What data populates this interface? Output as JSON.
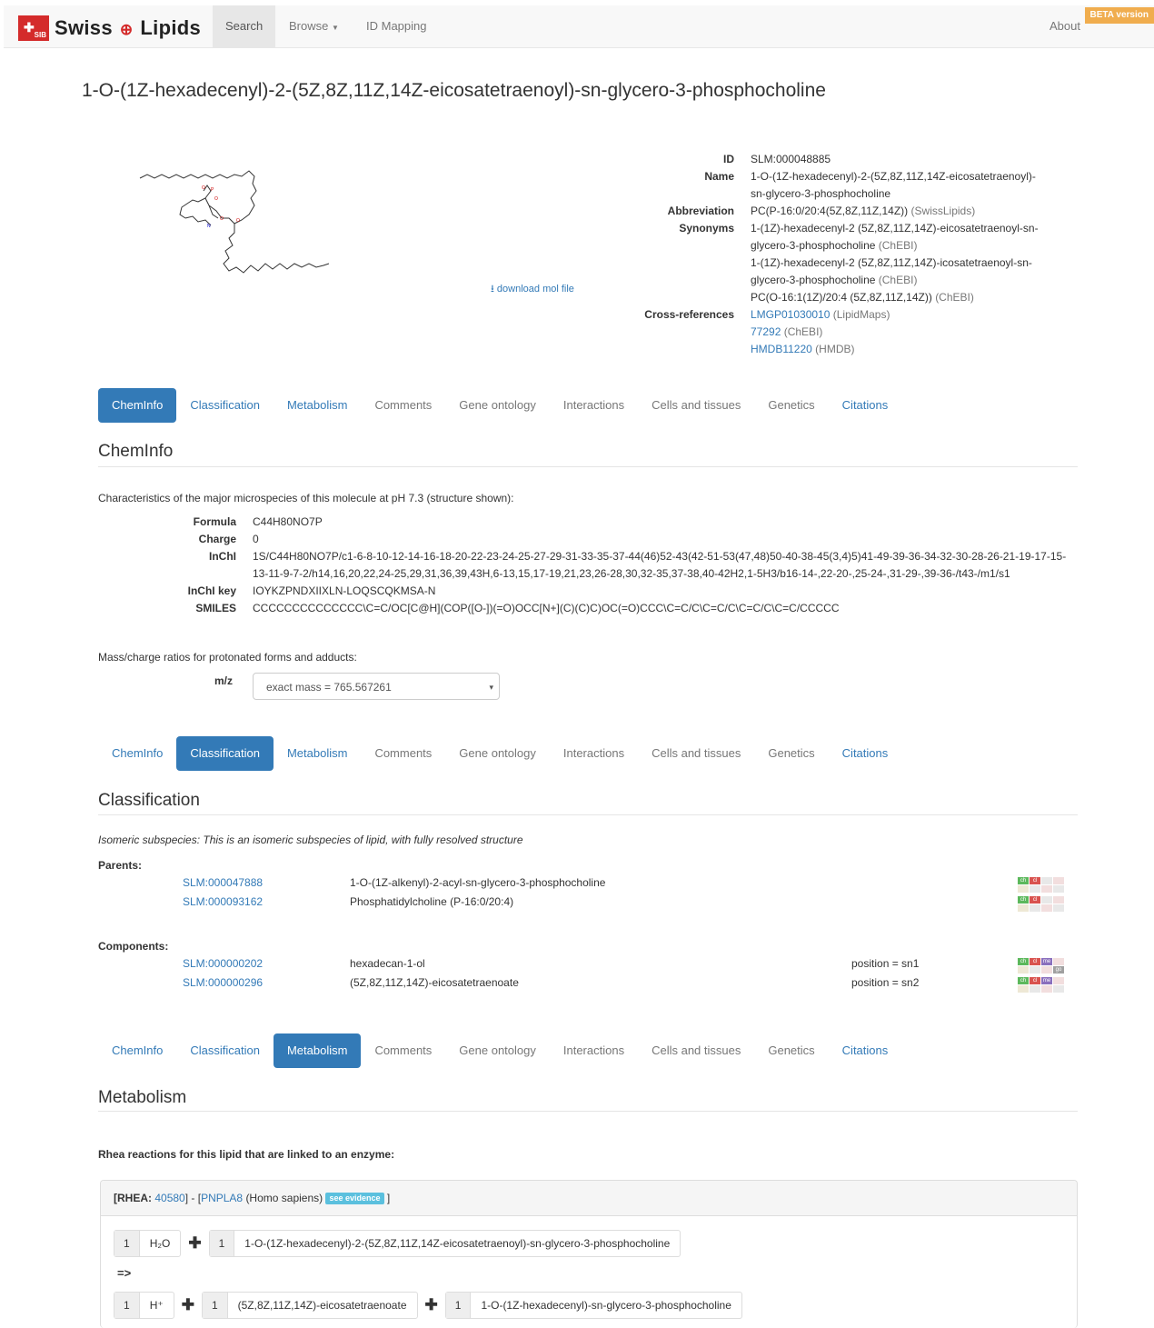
{
  "nav": {
    "brand_pre": "Sw",
    "brand_mid1": "iss",
    "brand_mid2": "L",
    "brand_mid3": "ip",
    "brand_mid4": "ids",
    "logo_text": "SIB",
    "search": "Search",
    "browse": "Browse",
    "id_mapping": "ID Mapping",
    "about": "About",
    "beta": "BETA version"
  },
  "title": "1-O-(1Z-hexadecenyl)-2-(5Z,8Z,11Z,14Z-eicosatetraenoyl)-sn-glycero-3-phosphocholine",
  "download": "download mol file",
  "props": {
    "id_label": "ID",
    "id": "SLM:000048885",
    "name_label": "Name",
    "name1": "1-O-(1Z-hexadecenyl)-2-(5Z,8Z,11Z,14Z-eicosatetraenoyl)-",
    "name2": "sn-glycero-3-phosphocholine",
    "abbr_label": "Abbreviation",
    "abbr": "PC(P-16:0/20:4(5Z,8Z,11Z,14Z))",
    "abbr_src": "(SwissLipids)",
    "syn_label": "Synonyms",
    "syn1a": "1-(1Z)-hexadecenyl-2 (5Z,8Z,11Z,14Z)-eicosatetraenoyl-sn-",
    "syn1b": "glycero-3-phosphocholine",
    "syn1_src": "(ChEBI)",
    "syn2a": "1-(1Z)-hexadecenyl-2 (5Z,8Z,11Z,14Z)-icosatetraenoyl-sn-",
    "syn2b": "glycero-3-phosphocholine",
    "syn2_src": "(ChEBI)",
    "syn3": "PC(O-16:1(1Z)/20:4 (5Z,8Z,11Z,14Z))",
    "syn3_src": "(ChEBI)",
    "xref_label": "Cross-references",
    "xref1": "LMGP01030010",
    "xref1_src": "(LipidMaps)",
    "xref2": "77292",
    "xref2_src": "(ChEBI)",
    "xref3": "HMDB11220",
    "xref3_src": "(HMDB)"
  },
  "tabs": [
    "ChemInfo",
    "Classification",
    "Metabolism",
    "Comments",
    "Gene ontology",
    "Interactions",
    "Cells and tissues",
    "Genetics",
    "Citations"
  ],
  "cheminfo": {
    "title": "ChemInfo",
    "intro": "Characteristics of the major microspecies of this molecule at pH 7.3 (structure shown):",
    "formula_label": "Formula",
    "formula": "C44H80NO7P",
    "charge_label": "Charge",
    "charge": "0",
    "inchi_label": "InChI",
    "inchi": "1S/C44H80NO7P/c1-6-8-10-12-14-16-18-20-22-23-24-25-27-29-31-33-35-37-44(46)52-43(42-51-53(47,48)50-40-38-45(3,4)5)41-49-39-36-34-32-30-28-26-21-19-17-15-13-11-9-7-2/h14,16,20,22,24-25,29,31,36,39,43H,6-13,15,17-19,21,23,26-28,30,32-35,37-38,40-42H2,1-5H3/b16-14-,22-20-,25-24-,31-29-,39-36-/t43-/m1/s1",
    "inchikey_label": "InChI key",
    "inchikey": "IOYKZPNDXIIXLN-LOQSCQKMSA-N",
    "smiles_label": "SMILES",
    "smiles": "CCCCCCCCCCCCCC\\C=C/OC[C@H](COP([O-])(=O)OCC[N+](C)(C)C)OC(=O)CCC\\C=C/C\\C=C/C\\C=C/C\\C=C/CCCCC",
    "mass_intro": "Mass/charge ratios for protonated forms and adducts:",
    "mz_label": "m/z",
    "mz_value": "exact mass = 765.567261"
  },
  "classification": {
    "title": "Classification",
    "subspecies": "Isomeric subspecies: This is an isomeric subspecies of lipid, with fully resolved structure",
    "parents_label": "Parents:",
    "parents": [
      {
        "id": "SLM:000047888",
        "name": "1-O-(1Z-alkenyl)-2-acyl-sn-glycero-3-phosphocholine"
      },
      {
        "id": "SLM:000093162",
        "name": "Phosphatidylcholine (P-16:0/20:4)"
      }
    ],
    "components_label": "Components:",
    "components": [
      {
        "id": "SLM:000000202",
        "name": "hexadecan-1-ol",
        "pos": "position = sn1"
      },
      {
        "id": "SLM:000000296",
        "name": "(5Z,8Z,11Z,14Z)-eicosatetraenoate",
        "pos": "position = sn2"
      }
    ],
    "badge_labels": {
      "ch": "ch",
      "cl": "cl",
      "me": "me",
      "go": "go"
    }
  },
  "metabolism": {
    "title": "Metabolism",
    "rhea_intro": "Rhea reactions for this lipid that are linked to an enzyme:",
    "rhea_prefix": "[RHEA:",
    "rhea_id": "40580",
    "rhea_mid": "] - [",
    "enzyme": "PNPLA8",
    "organism": "(Homo sapiens)",
    "evidence": "see evidence",
    "rhea_suffix": "]",
    "arrow": "=>",
    "lhs": [
      {
        "coef": "1",
        "name": "H₂O"
      },
      {
        "coef": "1",
        "name": "1-O-(1Z-hexadecenyl)-2-(5Z,8Z,11Z,14Z-eicosatetraenoyl)-sn-glycero-3-phosphocholine"
      }
    ],
    "rhs": [
      {
        "coef": "1",
        "name": "H⁺"
      },
      {
        "coef": "1",
        "name": "(5Z,8Z,11Z,14Z)-eicosatetraenoate"
      },
      {
        "coef": "1",
        "name": "1-O-(1Z-hexadecenyl)-sn-glycero-3-phosphocholine"
      }
    ]
  }
}
